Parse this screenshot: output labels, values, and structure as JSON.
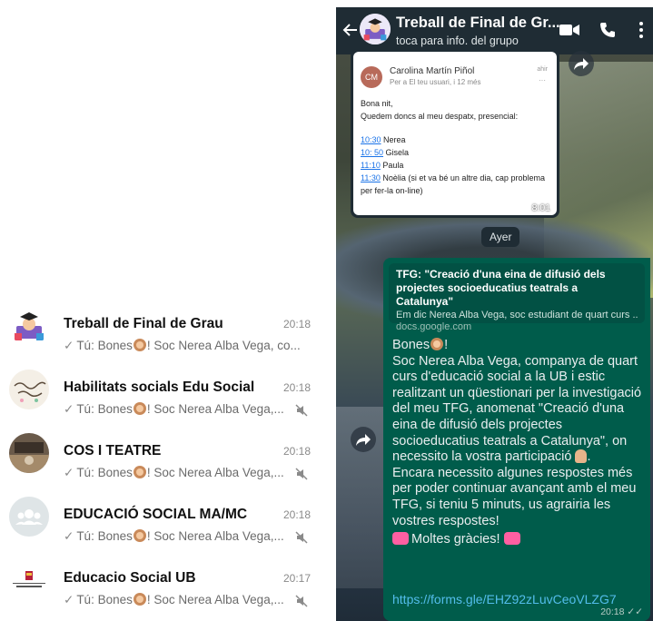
{
  "colors": {
    "header_bg": "#1f2c34",
    "outgoing_bubble": "#005c4b",
    "link_color": "#53bdeb",
    "time_gray": "#8a8a8a"
  },
  "chat_list": [
    {
      "name": "Treball de Final de Grau",
      "time": "20:18",
      "preview_prefix": "Tú: Bones",
      "preview_suffix": "! Soc Nerea Alba Vega, co...",
      "muted": false
    },
    {
      "name": "Habilitats socials Edu Social",
      "time": "20:18",
      "preview_prefix": "Tú: Bones",
      "preview_suffix": "! Soc Nerea Alba Vega,...",
      "muted": true
    },
    {
      "name": "COS I TEATRE",
      "time": "20:18",
      "preview_prefix": "Tú: Bones",
      "preview_suffix": "! Soc Nerea Alba Vega,...",
      "muted": true
    },
    {
      "name": "EDUCACIÓ SOCIAL MA/MC",
      "time": "20:18",
      "preview_prefix": "Tú: Bones",
      "preview_suffix": "! Soc Nerea Alba Vega,...",
      "muted": true
    },
    {
      "name": "Educacio Social UB",
      "time": "20:17",
      "preview_prefix": "Tú: Bones",
      "preview_suffix": "! Soc Nerea Alba Vega,...",
      "muted": true
    }
  ],
  "chat_view": {
    "title": "Treball de Final de Gr...",
    "subtitle": "toca para info. del grupo",
    "email_image": {
      "initials": "CM",
      "from": "Carolina Martín Piñol",
      "to": "Per a El teu usuari, i 12 més",
      "when": "ahir",
      "greeting": "Bona nit,",
      "line2": "Quedem doncs al meu despatx, presencial:",
      "slots": [
        {
          "time": "10:30",
          "name": " Nerea"
        },
        {
          "time": "10: 50",
          "name": " Gisela"
        },
        {
          "time": "11:10",
          "name": " Paula"
        },
        {
          "time": "11:30",
          "name": " Noèlia (si et va bé un altre dia, cap problema per fer-la on-line)"
        }
      ],
      "timestamp": "8:01"
    },
    "date_divider": "Ayer",
    "message": {
      "link_title": "TFG: \"Creació d'una eina de difusió dels projectes socioeducatius teatrals a Catalunya\"",
      "link_desc": "Em dic Nerea Alba Vega, soc estudiant de quart curs ...",
      "link_site": "docs.google.com",
      "greeting": "Bones",
      "greeting_end": "!",
      "body1": "Soc Nerea Alba Vega, companya de quart curs d'educació social a la UB i estic realitzant un qüestionari per la investigació del meu TFG, anomenat \"Creació d'una eina de difusió dels projectes socioeducatius teatrals a Catalunya\", on necessito la vostra participació",
      "body1_end": ".",
      "body2": "Encara necessito algunes respostes més per poder continuar avançant amb el meu TFG, si teniu 5 minuts, us agrairia les vostres respostes!",
      "thanks": "Moltes gràcies!",
      "url": "https://forms.gle/EHZ92zLuvCeoVLZG7",
      "time": "20:18"
    }
  }
}
